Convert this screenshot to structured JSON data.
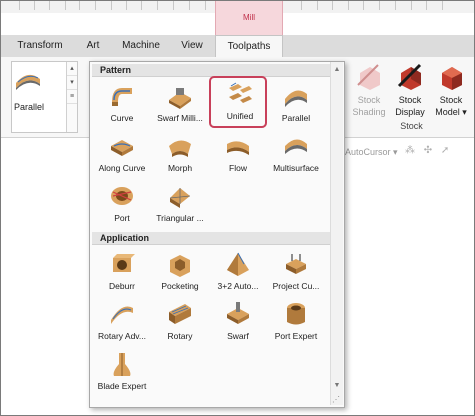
{
  "ribbon_tabs": [
    {
      "label": "Transform",
      "active": false
    },
    {
      "label": "Art",
      "active": false
    },
    {
      "label": "Machine",
      "active": false
    },
    {
      "label": "View",
      "active": false
    },
    {
      "label": "Toolpaths",
      "active": true
    }
  ],
  "context_tab": {
    "label": "Mill",
    "color": "#c0304a"
  },
  "gallery": {
    "label": "Parallel",
    "scroll_up": "▴",
    "scroll_down": "▾",
    "more": "≡"
  },
  "stock": {
    "group_label": "Stock",
    "buttons": [
      {
        "label_line1": "Stock",
        "label_line2": "Shading",
        "icon": "stock-shading-icon",
        "enabled": false
      },
      {
        "label_line1": "Stock",
        "label_line2": "Display",
        "icon": "stock-display-icon",
        "enabled": true
      },
      {
        "label_line1": "Stock",
        "label_line2": "Model ▾",
        "icon": "stock-model-icon",
        "enabled": true
      }
    ]
  },
  "autocursor": {
    "label": "AutoCursor ▾",
    "icons": "⁂ ✣ ➚"
  },
  "dropdown": {
    "sections": [
      {
        "header": "Pattern",
        "items": [
          {
            "label": "Curve",
            "icon": "curve-icon"
          },
          {
            "label": "Swarf Milli...",
            "icon": "swarf-milling-icon"
          },
          {
            "label": "Unified",
            "icon": "unified-icon",
            "selected": true
          },
          {
            "label": "Parallel",
            "icon": "parallel-icon"
          },
          {
            "label": "Along Curve",
            "icon": "along-curve-icon"
          },
          {
            "label": "Morph",
            "icon": "morph-icon"
          },
          {
            "label": "Flow",
            "icon": "flow-icon"
          },
          {
            "label": "Multisurface",
            "icon": "multisurface-icon"
          },
          {
            "label": "Port",
            "icon": "port-icon"
          },
          {
            "label": "Triangular ...",
            "icon": "triangular-icon"
          }
        ]
      },
      {
        "header": "Application",
        "items": [
          {
            "label": "Deburr",
            "icon": "deburr-icon"
          },
          {
            "label": "Pocketing",
            "icon": "pocketing-icon"
          },
          {
            "label": "3+2 Auto...",
            "icon": "3-plus-2-auto-icon"
          },
          {
            "label": "Project Cu...",
            "icon": "project-curve-icon"
          },
          {
            "label": "Rotary Adv...",
            "icon": "rotary-advanced-icon"
          },
          {
            "label": "Rotary",
            "icon": "rotary-icon"
          },
          {
            "label": "Swarf",
            "icon": "swarf-icon"
          },
          {
            "label": "Port Expert",
            "icon": "port-expert-icon"
          },
          {
            "label": "Blade Expert",
            "icon": "blade-expert-icon"
          }
        ]
      }
    ],
    "scroll_up": "▲",
    "scroll_down": "▼",
    "grip": "⋰"
  }
}
